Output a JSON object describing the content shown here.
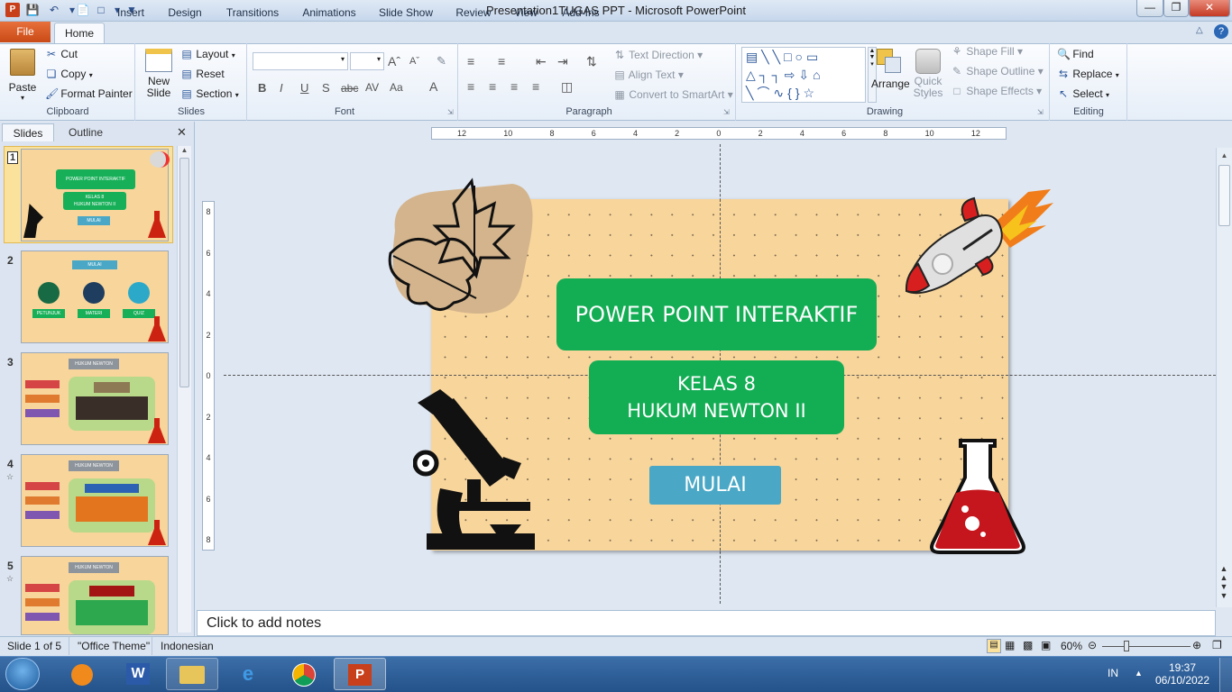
{
  "window": {
    "title": "Presentation1TUGAS PPT  -  Microsoft PowerPoint"
  },
  "tabs": {
    "file": "File",
    "items": [
      "Home",
      "Insert",
      "Design",
      "Transitions",
      "Animations",
      "Slide Show",
      "Review",
      "View",
      "Add-Ins"
    ]
  },
  "ribbon": {
    "clipboard": {
      "label": "Clipboard",
      "paste": "Paste",
      "cut": "Cut",
      "copy": "Copy",
      "format_painter": "Format Painter"
    },
    "slides": {
      "label": "Slides",
      "new_slide": "New Slide",
      "layout": "Layout",
      "reset": "Reset",
      "section": "Section"
    },
    "font": {
      "label": "Font",
      "bold": "B",
      "italic": "I",
      "underline": "U",
      "shadow": "S",
      "strike": "abc"
    },
    "paragraph": {
      "label": "Paragraph",
      "text_direction": "Text Direction",
      "align_text": "Align Text",
      "smartart": "Convert to SmartArt"
    },
    "drawing": {
      "label": "Drawing",
      "arrange": "Arrange",
      "quick_styles": "Quick Styles",
      "shape_fill": "Shape Fill",
      "shape_outline": "Shape Outline",
      "shape_effects": "Shape Effects"
    },
    "editing": {
      "label": "Editing",
      "find": "Find",
      "replace": "Replace",
      "select": "Select"
    }
  },
  "panel": {
    "tabs": [
      "Slides",
      "Outline"
    ],
    "thumbs": [
      {
        "num": "1",
        "title": "POWER POINT INTERAKTIF",
        "sub1": "KELAS 8",
        "sub2": "HUKUM NEWTON II",
        "btn": "MULAI"
      },
      {
        "num": "2",
        "title": "MULAI",
        "items": [
          "PETUNJUK",
          "MATERI",
          "QUIZ"
        ]
      },
      {
        "num": "3",
        "title": "HUKUM NEWTON"
      },
      {
        "num": "4",
        "title": "HUKUM NEWTON"
      },
      {
        "num": "5",
        "title": "HUKUM NEWTON"
      }
    ]
  },
  "ruler": {
    "h_labels": [
      "12",
      "10",
      "8",
      "6",
      "4",
      "2",
      "0",
      "2",
      "4",
      "6",
      "8",
      "10",
      "12"
    ],
    "v_labels": [
      "8",
      "6",
      "4",
      "2",
      "0",
      "2",
      "4",
      "6",
      "8"
    ]
  },
  "slide": {
    "title": "POWER POINT INTERAKTIF",
    "subtitle_line1": "KELAS 8",
    "subtitle_line2": "HUKUM NEWTON II",
    "button": "MULAI"
  },
  "notes": {
    "placeholder": "Click to add notes"
  },
  "status": {
    "slide": "Slide 1 of 5",
    "theme": "\"Office Theme\"",
    "language": "Indonesian",
    "zoom": "60%"
  },
  "taskbar": {
    "lang": "IN",
    "time": "19:37",
    "date": "06/10/2022"
  },
  "colors": {
    "slide_bg": "#f8d59b",
    "green": "#13ad54",
    "mulai": "#4aa8c6",
    "file_tab": "#d9541f"
  }
}
